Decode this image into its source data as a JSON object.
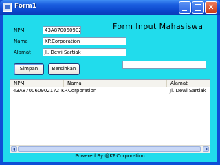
{
  "window": {
    "title": "Form1",
    "icons": [
      "app-form-icon",
      "minimize-icon",
      "maximize-icon",
      "close-icon"
    ]
  },
  "form": {
    "heading": "Form Input Mahasiswa",
    "fields": {
      "npm": {
        "label": "NPM",
        "value": "43A870060902172"
      },
      "nama": {
        "label": "Nama",
        "value": "KP.Corporation"
      },
      "alamat": {
        "label": "Alamat",
        "value": "Jl. Dewi Sartiak"
      }
    },
    "extra_field_value": "",
    "buttons": {
      "simpan": "Simpan",
      "bersihkan": "Bersihkan"
    }
  },
  "grid": {
    "columns": [
      "NPM",
      "Nama",
      "Alamat"
    ],
    "rows": [
      [
        "43A870060902172",
        "KP.Corporation",
        "Jl. Dewi Sartiak"
      ]
    ]
  },
  "footer": "Powered By @KP.Corporation",
  "colors": {
    "client_background": "#21dcec",
    "titlebar": "#0a44c9"
  }
}
